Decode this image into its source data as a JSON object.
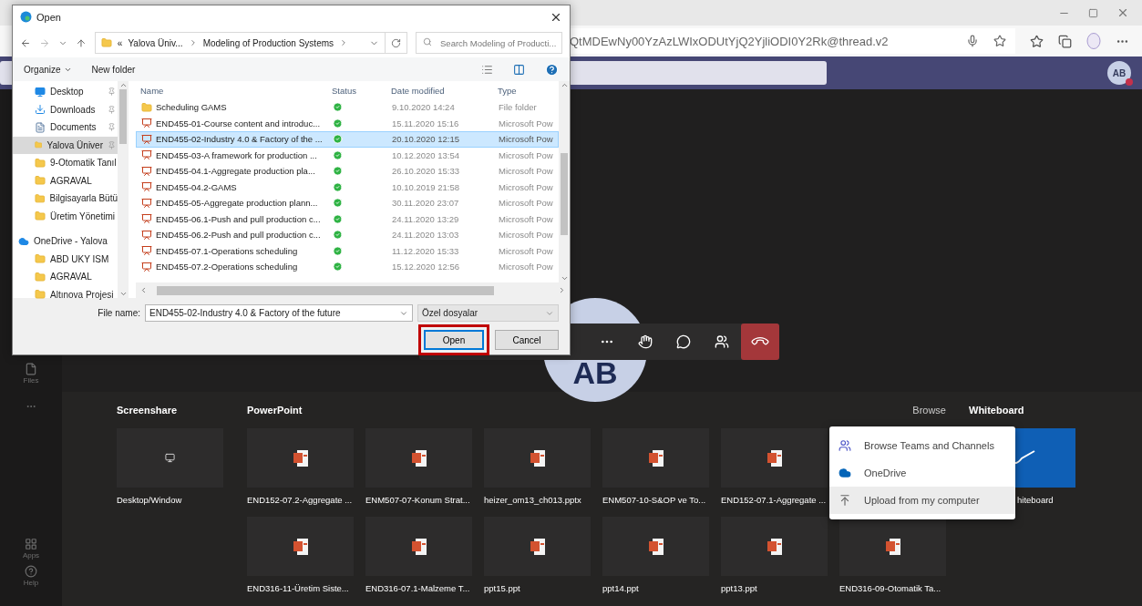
{
  "browser": {
    "url": "QtMDEwNy00YzAzLWIxODUtYjQ2YjliODI0Y2Rk@thread.v2"
  },
  "teams": {
    "avatar": "AB",
    "rail": [
      {
        "label": "Files",
        "kind": "files"
      },
      {
        "label": "Apps",
        "kind": "apps"
      },
      {
        "label": "Help",
        "kind": "help"
      }
    ]
  },
  "call": {
    "initials": "AB"
  },
  "share": {
    "sections": [
      "Screenshare",
      "PowerPoint"
    ],
    "links": [
      {
        "label": "Browse",
        "selected": false
      },
      {
        "label": "Whiteboard",
        "selected": true
      }
    ],
    "screenshare": [
      {
        "label": "Desktop/Window"
      }
    ],
    "powerpoint_row_1": [
      "END152-07.2-Aggregate ...",
      "ENM507-07-Konum Strat...",
      "heizer_om13_ch013.pptx",
      "ENM507-10-S&OP ve To...",
      "END152-07.1-Aggregate ..."
    ],
    "powerpoint_row_2": [
      "END316-11-Üretim Siste...",
      "END316-07.1-Malzeme T...",
      "ppt15.ppt",
      "ppt14.ppt",
      "ppt13.ppt",
      "END316-09-Otomatik Ta..."
    ],
    "whiteboard_label": "hiteboard"
  },
  "browse_menu": [
    {
      "label": "Browse Teams and Channels",
      "kind": "teams",
      "highlighted": false
    },
    {
      "label": "OneDrive",
      "kind": "cloud",
      "highlighted": false
    },
    {
      "label": "Upload from my computer",
      "kind": "upload",
      "highlighted": true
    }
  ],
  "dialog": {
    "title": "Open",
    "path_overflow": "«",
    "path": [
      "Yalova Üniv...",
      "Modeling of Production Systems"
    ],
    "file_name_label": "File name:",
    "search": {
      "placeholder": "Search Modeling of Producti..."
    },
    "toolbar": [
      "Organize",
      "New folder"
    ],
    "nav_items": [
      {
        "label": "Desktop",
        "kind": "desktop",
        "pinned": true,
        "selected": false
      },
      {
        "label": "Downloads",
        "kind": "download",
        "pinned": true,
        "selected": false
      },
      {
        "label": "Documents",
        "kind": "document",
        "pinned": true,
        "selected": false
      },
      {
        "label": "Yalova Üniver",
        "kind": "folder",
        "pinned": true,
        "selected": true
      },
      {
        "label": "9-Otomatik Tanıl",
        "kind": "folder",
        "pinned": false,
        "selected": false
      },
      {
        "label": "AGRAVAL",
        "kind": "folder",
        "pinned": false,
        "selected": false
      },
      {
        "label": "Bilgisayarla Bütü",
        "kind": "folder",
        "pinned": false,
        "selected": false
      },
      {
        "label": "Üretim Yönetimi",
        "kind": "folder",
        "pinned": false,
        "selected": false
      },
      {
        "label": "OneDrive - Yalova",
        "kind": "cloud",
        "pinned": false,
        "selected": false
      },
      {
        "label": "ABD UKY ISM",
        "kind": "folder",
        "pinned": false,
        "selected": false
      },
      {
        "label": "AGRAVAL",
        "kind": "folder",
        "pinned": false,
        "selected": false
      },
      {
        "label": "Altınova Projesi",
        "kind": "folder",
        "pinned": false,
        "selected": false
      }
    ],
    "columns": [
      "Name",
      "Status",
      "Date modified",
      "Type"
    ],
    "files": [
      {
        "name": "Scheduling GAMS",
        "kind": "folder",
        "date": "9.10.2020 14:24",
        "type": "File folder",
        "selected": false
      },
      {
        "name": "END455-01-Course content and introduc...",
        "kind": "ppt",
        "date": "15.11.2020 15:16",
        "type": "Microsoft Pow",
        "selected": false
      },
      {
        "name": "END455-02-Industry 4.0 & Factory of the ...",
        "kind": "ppt",
        "date": "20.10.2020 12:15",
        "type": "Microsoft Pow",
        "selected": true
      },
      {
        "name": "END455-03-A framework for production ...",
        "kind": "ppt",
        "date": "10.12.2020 13:54",
        "type": "Microsoft Pow",
        "selected": false
      },
      {
        "name": "END455-04.1-Aggregate production pla...",
        "kind": "ppt",
        "date": "26.10.2020 15:33",
        "type": "Microsoft Pow",
        "selected": false
      },
      {
        "name": "END455-04.2-GAMS",
        "kind": "ppt",
        "date": "10.10.2019 21:58",
        "type": "Microsoft Pow",
        "selected": false
      },
      {
        "name": "END455-05-Aggregate production plann...",
        "kind": "ppt",
        "date": "30.11.2020 23:07",
        "type": "Microsoft Pow",
        "selected": false
      },
      {
        "name": "END455-06.1-Push and pull production c...",
        "kind": "ppt",
        "date": "24.11.2020 13:29",
        "type": "Microsoft Pow",
        "selected": false
      },
      {
        "name": "END455-06.2-Push and pull production c...",
        "kind": "ppt",
        "date": "24.11.2020 13:03",
        "type": "Microsoft Pow",
        "selected": false
      },
      {
        "name": "END455-07.1-Operations scheduling",
        "kind": "ppt",
        "date": "11.12.2020 15:33",
        "type": "Microsoft Pow",
        "selected": false
      },
      {
        "name": "END455-07.2-Operations scheduling",
        "kind": "ppt",
        "date": "15.12.2020 12:56",
        "type": "Microsoft Pow",
        "selected": false
      }
    ],
    "file_name": "END455-02-Industry 4.0 & Factory of the future",
    "file_type": "Özel dosyalar",
    "buttons": [
      {
        "label": "Open",
        "default": true,
        "highlighted": true
      },
      {
        "label": "Cancel",
        "default": false,
        "highlighted": false
      }
    ]
  }
}
